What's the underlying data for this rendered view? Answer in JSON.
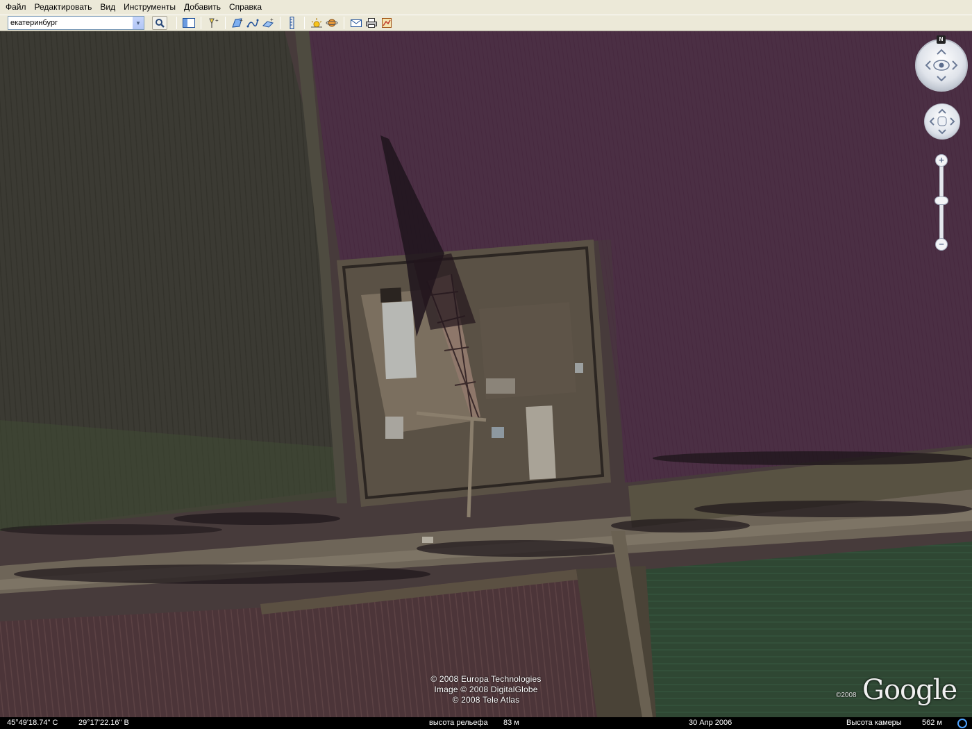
{
  "menu": [
    "Файл",
    "Редактировать",
    "Вид",
    "Инструменты",
    "Добавить",
    "Справка"
  ],
  "search": {
    "value": "екатеринбург"
  },
  "toolbar_icons": [
    "search-icon",
    "sidebar-icon",
    "placemark-icon",
    "polygon-icon",
    "path-icon",
    "image-overlay-icon",
    "ruler-icon",
    "sunlight-icon",
    "sky-icon",
    "email-icon",
    "print-icon",
    "view-in-maps-icon"
  ],
  "navigation": {
    "north_label": "N",
    "zoom_level": 0.4
  },
  "copyright": [
    "© 2008 Europa Technologies",
    "Image © 2008 DigitalGlobe",
    "© 2008 Tele Atlas"
  ],
  "logo": {
    "year": "©2008",
    "text": "Google"
  },
  "status": {
    "lat": "45°49'18.74\" С",
    "lon": "29°17'22.16\" В",
    "elevation_label": "высота рельефа",
    "elevation_value": "83 м",
    "date": "30 Апр 2006",
    "eye_label": "Высота камеры",
    "eye_value": "562 м"
  },
  "colors": {
    "field_purple": "#4a2e42",
    "field_green": "#2f4532",
    "road": "#6b6255",
    "ui_gray": "#ece9d8"
  }
}
